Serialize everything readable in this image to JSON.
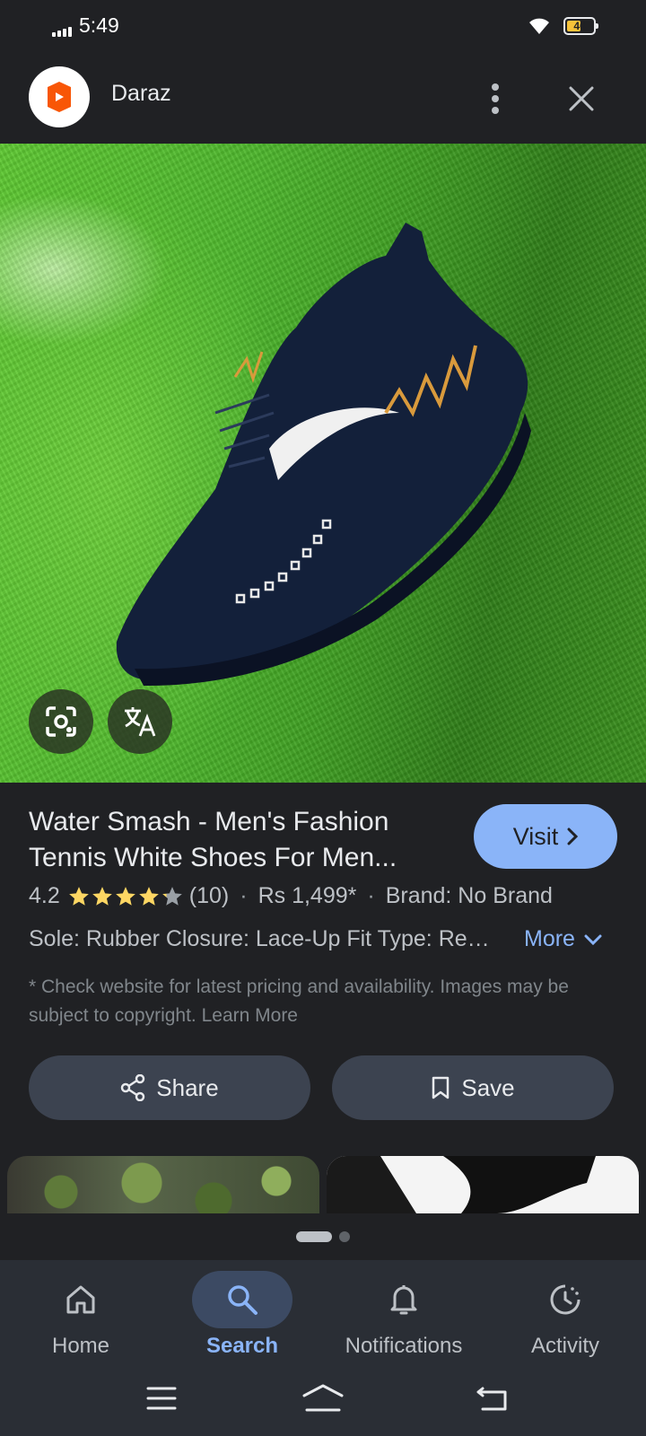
{
  "status_bar": {
    "time": "5:49",
    "battery_level": "46"
  },
  "header": {
    "site_name": "Daraz",
    "logo_color": "#f85606"
  },
  "product": {
    "title": "Water Smash - Men's Fashion Tennis White Shoes For Men...",
    "visit_label": "Visit",
    "rating": "4.2",
    "rating_stars": 4.2,
    "review_count": "(10)",
    "price": "Rs 1,499*",
    "brand": "Brand: No Brand",
    "specs": "Sole: Rubber Closure: Lace-Up Fit Type: Regular",
    "more_label": "More",
    "disclaimer": "* Check website for latest pricing and availability. Images may be subject to copyright. Learn More"
  },
  "actions": {
    "share_label": "Share",
    "save_label": "Save"
  },
  "bottom_nav": {
    "items": [
      {
        "label": "Home",
        "icon": "home-icon"
      },
      {
        "label": "Search",
        "icon": "search-icon",
        "active": true
      },
      {
        "label": "Notifications",
        "icon": "bell-icon"
      },
      {
        "label": "Activity",
        "icon": "activity-icon"
      }
    ]
  },
  "colors": {
    "accent": "#8ab4f8",
    "background": "#202124",
    "star": "#fdd663"
  }
}
